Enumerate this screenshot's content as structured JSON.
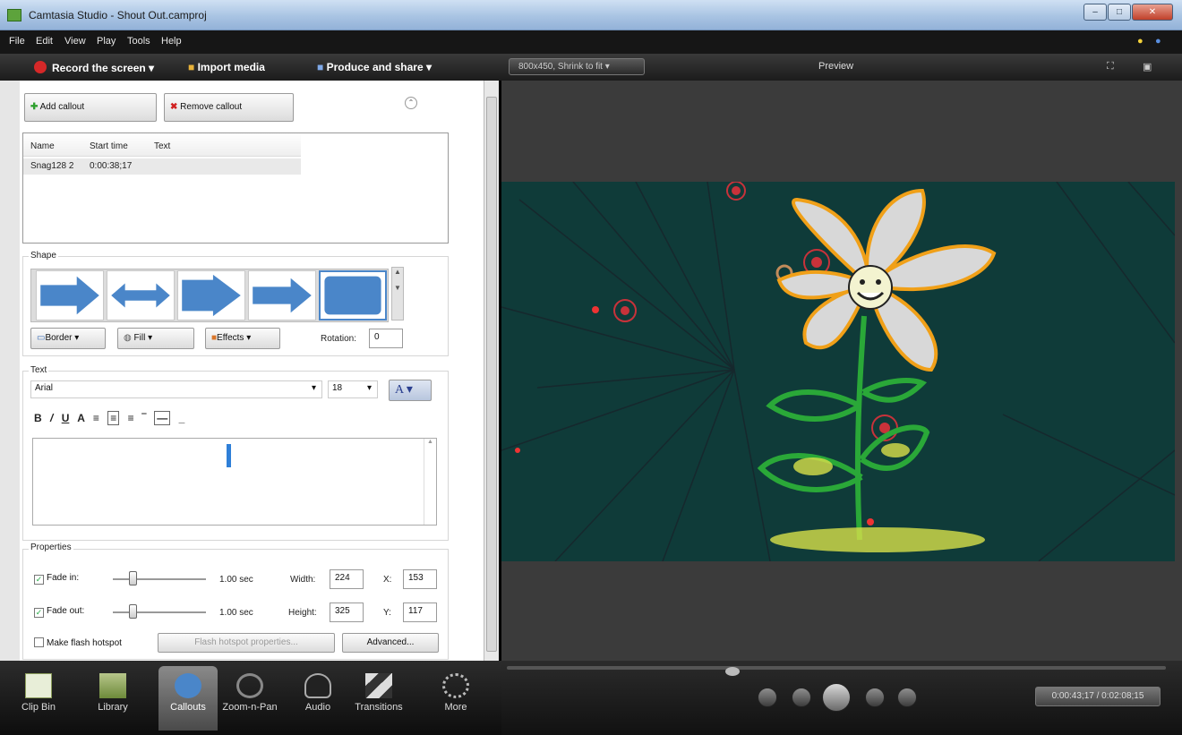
{
  "window": {
    "title": "Camtasia Studio - Shout Out.camproj"
  },
  "menu": [
    "File",
    "Edit",
    "View",
    "Play",
    "Tools",
    "Help"
  ],
  "toolbar": {
    "record": "Record the screen",
    "import": "Import media",
    "produce": "Produce and share"
  },
  "callouts": {
    "add_label": "Add callout",
    "remove_label": "Remove callout",
    "table": {
      "columns": [
        "Name",
        "Start time",
        "Text"
      ],
      "rows": [
        [
          "Snag128 2",
          "0:00:38;17",
          ""
        ]
      ]
    },
    "shape_section": "Shape",
    "border_label": "Border",
    "fill_label": "Fill",
    "effects_label": "Effects",
    "rotation_label": "Rotation:",
    "rotation_value": "0",
    "text_section": "Text",
    "font": "Arial",
    "font_size": "18",
    "properties_section": "Properties",
    "fade_in_label": "Fade in:",
    "fade_in_value": "1.00 sec",
    "fade_in_checked": true,
    "fade_out_label": "Fade out:",
    "fade_out_value": "1.00 sec",
    "fade_out_checked": true,
    "width_label": "Width:",
    "width_value": "224",
    "height_label": "Height:",
    "height_value": "325",
    "x_label": "X:",
    "x_value": "153",
    "y_label": "Y:",
    "y_value": "117",
    "flash_hotspot_label": "Make flash hotspot",
    "flash_props_label": "Flash hotspot properties...",
    "advanced_label": "Advanced..."
  },
  "tabs": [
    {
      "label": "Clip Bin"
    },
    {
      "label": "Library"
    },
    {
      "label": "Callouts",
      "active": true
    },
    {
      "label": "Zoom-n-Pan"
    },
    {
      "label": "Audio"
    },
    {
      "label": "Transitions"
    },
    {
      "label": "More"
    }
  ],
  "preview": {
    "size": "800x450, Shrink to fit",
    "title": "Preview",
    "time": "0:00:43;17 / 0:02:08;15"
  },
  "colors": {
    "accent": "#d62828",
    "video_bg": "#0f3b39",
    "shape_blue": "#4a86c9"
  }
}
